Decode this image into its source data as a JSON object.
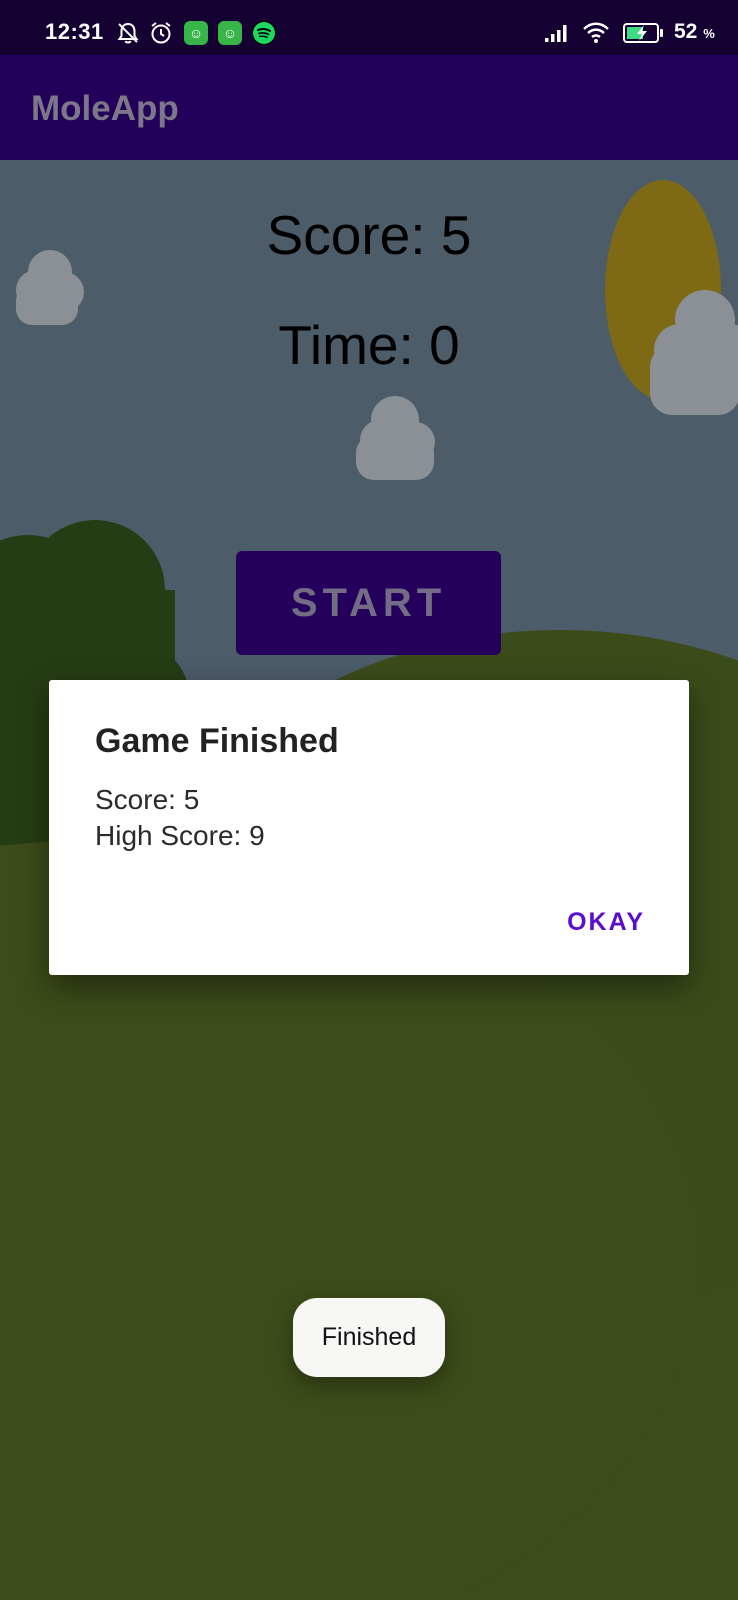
{
  "status_bar": {
    "time": "12:31",
    "battery_percent": "52",
    "battery_unit": "%",
    "icons": [
      "notifications-muted-icon",
      "alarm-icon",
      "app-notification-icon",
      "app-notification-icon",
      "spotify-icon",
      "signal-icon",
      "wifi-icon",
      "battery-charging-icon"
    ]
  },
  "app_bar": {
    "title": "MoleApp"
  },
  "game": {
    "score_text": "Score: 5",
    "time_text": "Time: 0",
    "start_label": "START"
  },
  "dialog": {
    "title": "Game Finished",
    "score_line": "Score: 5",
    "high_score_line": "High Score: 9",
    "okay_label": "OKAY"
  },
  "toast": {
    "message": "Finished"
  },
  "colors": {
    "status_bar_bg": "#140031",
    "app_bar_bg": "#230059",
    "accent": "#5a0ccf",
    "sky_dimmed": "#4c5c69",
    "grass_dimmed": "#3d4c1a"
  }
}
